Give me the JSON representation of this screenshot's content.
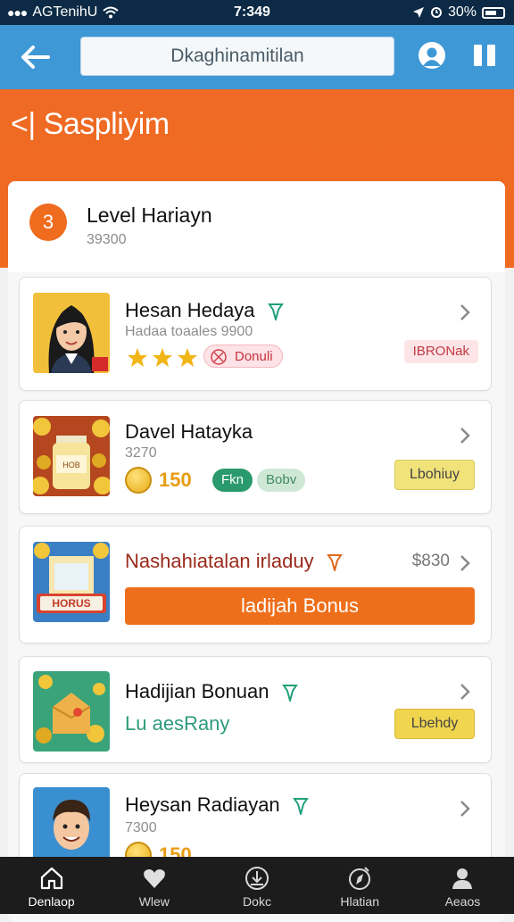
{
  "status_bar": {
    "carrier": "AGTenihU",
    "time": "7:349",
    "battery": "30%"
  },
  "navbar": {
    "search_text": "Dkaghinamitilan"
  },
  "page": {
    "title": "Saspliyim"
  },
  "level": {
    "badge": "3",
    "title": "Level Hariayn",
    "subtitle": "39300"
  },
  "cards": [
    {
      "title": "Hesan Hedaya",
      "subtitle": "Hadaa toaales 9900",
      "rating": 3,
      "chip": "Donuli",
      "tag": "IBRONak"
    },
    {
      "title": "Davel Hatayka",
      "subtitle": "3270",
      "coin_value": "150",
      "chip_a": "Fkn",
      "chip_b": "Bobv",
      "action": "Lbohiuy"
    },
    {
      "title": "Nashahiatalan irladuy",
      "price": "$830",
      "action": "ladijah Bonus",
      "thumb_label": "HORUS"
    },
    {
      "title": "Hadijian Bonuan",
      "subtitle": "Lu aesRany",
      "action": "Lbehdy"
    },
    {
      "title": "Heysan Radiayan",
      "subtitle": "7300",
      "coin_value": "150"
    }
  ],
  "tabs": [
    {
      "label": "Denlaop",
      "icon": "home-icon"
    },
    {
      "label": "Wlew",
      "icon": "heart-icon"
    },
    {
      "label": "Dokc",
      "icon": "download-icon"
    },
    {
      "label": "Hlatian",
      "icon": "compass-icon"
    },
    {
      "label": "Aeaos",
      "icon": "person-icon"
    }
  ],
  "colors": {
    "status_bar": "#0c2a45",
    "navbar": "#3f98d6",
    "accent": "#ef6a24",
    "tabbar": "#1c1c1c"
  }
}
